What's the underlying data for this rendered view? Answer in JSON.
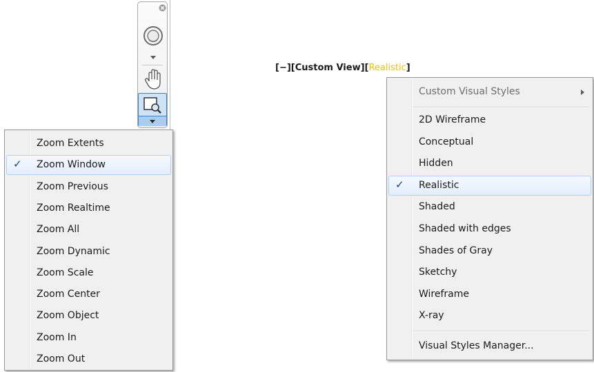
{
  "nav_bar": {
    "close_icon": "close-icon",
    "wheel_icon": "steering-wheel-icon",
    "pan_icon": "pan-hand-icon",
    "zoom_icon": "zoom-window-icon"
  },
  "zoom_menu": {
    "items": [
      {
        "label": "Zoom Extents",
        "checked": false
      },
      {
        "label": "Zoom Window",
        "checked": true
      },
      {
        "label": "Zoom Previous",
        "checked": false
      },
      {
        "label": "Zoom Realtime",
        "checked": false
      },
      {
        "label": "Zoom All",
        "checked": false
      },
      {
        "label": "Zoom Dynamic",
        "checked": false
      },
      {
        "label": "Zoom Scale",
        "checked": false
      },
      {
        "label": "Zoom Center",
        "checked": false
      },
      {
        "label": "Zoom Object",
        "checked": false
      },
      {
        "label": "Zoom In",
        "checked": false
      },
      {
        "label": "Zoom Out",
        "checked": false
      }
    ]
  },
  "viewport_label": {
    "minus": "[−]",
    "view": "[Custom View]",
    "style_open": "[",
    "style": "Realistic",
    "style_close": "]",
    "highlight_color": "#f2c200"
  },
  "style_menu": {
    "custom_styles": "Custom Visual Styles",
    "items": [
      {
        "label": "2D Wireframe",
        "checked": false
      },
      {
        "label": "Conceptual",
        "checked": false
      },
      {
        "label": "Hidden",
        "checked": false
      },
      {
        "label": "Realistic",
        "checked": true
      },
      {
        "label": "Shaded",
        "checked": false
      },
      {
        "label": "Shaded with edges",
        "checked": false
      },
      {
        "label": "Shades of Gray",
        "checked": false
      },
      {
        "label": "Sketchy",
        "checked": false
      },
      {
        "label": "Wireframe",
        "checked": false
      },
      {
        "label": "X-ray",
        "checked": false
      }
    ],
    "manager": "Visual Styles Manager...",
    "check_glyph": "✓"
  }
}
